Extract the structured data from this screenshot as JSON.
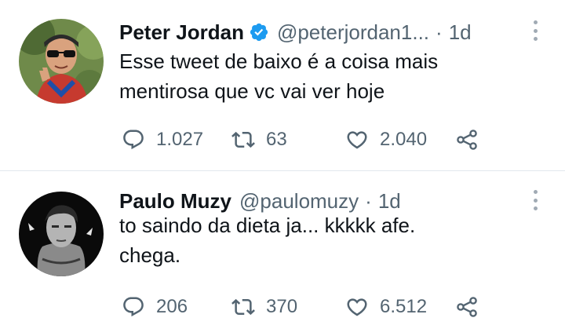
{
  "tweets": [
    {
      "name": "Peter Jordan",
      "verified": true,
      "handle": "@peterjordan1...",
      "separator": "·",
      "time": "1d",
      "text_lines": [
        "Esse tweet de baixo é a coisa mais",
        "mentirosa que vc vai ver hoje"
      ],
      "replies": "1.027",
      "retweets": "63",
      "likes": "2.040"
    },
    {
      "name": "Paulo Muzy",
      "verified": false,
      "handle": "@paulomuzy",
      "separator": "·",
      "time": "1d",
      "text_lines": [
        "to saindo da dieta ja... kkkkk afe.",
        "chega."
      ],
      "replies": "206",
      "retweets": "370",
      "likes": "6.512"
    }
  ],
  "colors": {
    "verified_badge": "#1d9bf0",
    "secondary_text": "#536471",
    "divider": "#e1e8ed"
  },
  "icons": [
    "reply-icon",
    "retweet-icon",
    "like-icon",
    "share-icon",
    "more-icon",
    "verified-badge-icon"
  ]
}
